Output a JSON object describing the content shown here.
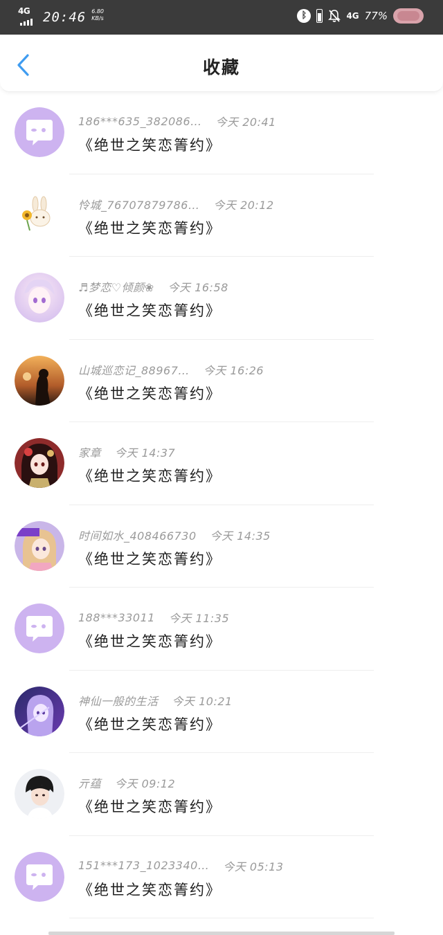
{
  "status_bar": {
    "network": "4G",
    "time": "20:46",
    "speed_value": "6.80",
    "speed_unit": "KB/s",
    "network_right": "4G",
    "battery_pct": "77%"
  },
  "header": {
    "title": "收藏"
  },
  "items": [
    {
      "name": "186***635_382086…",
      "time": "今天 20:41",
      "title": "《绝世之笑恋箐约》",
      "avatar": "default"
    },
    {
      "name": "怜城_76707879786…",
      "time": "今天 20:12",
      "title": "《绝世之笑恋箐约》",
      "avatar": "bunny"
    },
    {
      "name": "♬梦恋♡倾颜❀",
      "time": "今天 16:58",
      "title": "《绝世之笑恋箐约》",
      "avatar": "anime-pink"
    },
    {
      "name": "山城巡恋记_88967…",
      "time": "今天 16:26",
      "title": "《绝世之笑恋箐约》",
      "avatar": "sunset"
    },
    {
      "name": "家章",
      "time": "今天 14:37",
      "title": "《绝世之笑恋箐约》",
      "avatar": "anime-red"
    },
    {
      "name": "时间如水_408466730",
      "time": "今天 14:35",
      "title": "《绝世之笑恋箐约》",
      "avatar": "anime-blonde"
    },
    {
      "name": "188***33011",
      "time": "今天 11:35",
      "title": "《绝世之笑恋箐约》",
      "avatar": "default"
    },
    {
      "name": "神仙一般的生活",
      "time": "今天 10:21",
      "title": "《绝世之笑恋箐约》",
      "avatar": "anime-purple"
    },
    {
      "name": "亓蕴",
      "time": "今天 09:12",
      "title": "《绝世之笑恋箐约》",
      "avatar": "person"
    },
    {
      "name": "151***173_1023340…",
      "time": "今天 05:13",
      "title": "《绝世之笑恋箐约》",
      "avatar": "default"
    }
  ],
  "colors": {
    "status_bar_bg": "#3b3b3b",
    "back_arrow": "#3f9cf0",
    "default_avatar": "#cdb3f0",
    "meta_text": "#9a9a9a",
    "title_text": "#1e1e1e"
  }
}
